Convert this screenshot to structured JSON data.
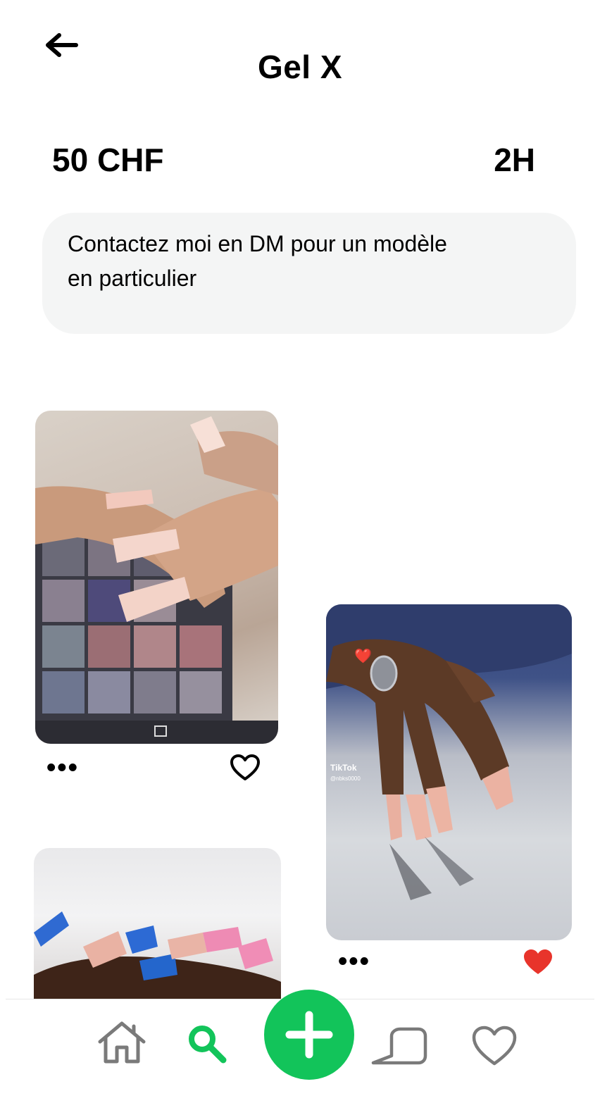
{
  "header": {
    "title": "Gel X",
    "back_icon": "arrow-left-icon"
  },
  "service": {
    "price": "50 CHF",
    "duration": "2H",
    "description_line1": "Contactez moi en DM pour un modèle",
    "description_line2": "en particulier"
  },
  "posts": [
    {
      "image": "ombre-nails-photo",
      "more_label": "•••",
      "liked": false,
      "like_icon": "heart-outline-icon"
    },
    {
      "image": "nude-coffin-nails-photo",
      "more_label": "•••",
      "liked": true,
      "like_icon": "heart-filled-icon",
      "watermark": "TikTok",
      "watermark_handle": "@nbks0000"
    },
    {
      "image": "blue-pink-french-nails-photo"
    }
  ],
  "bottom_nav": {
    "items": [
      "home-icon",
      "search-icon",
      "add-icon",
      "messages-icon",
      "favorites-icon"
    ],
    "active": "search-icon"
  },
  "colors": {
    "accent": "#12c45a",
    "like": "#e8342b",
    "icon_gray": "#7a7a7a",
    "desc_bg": "#f4f5f5"
  }
}
